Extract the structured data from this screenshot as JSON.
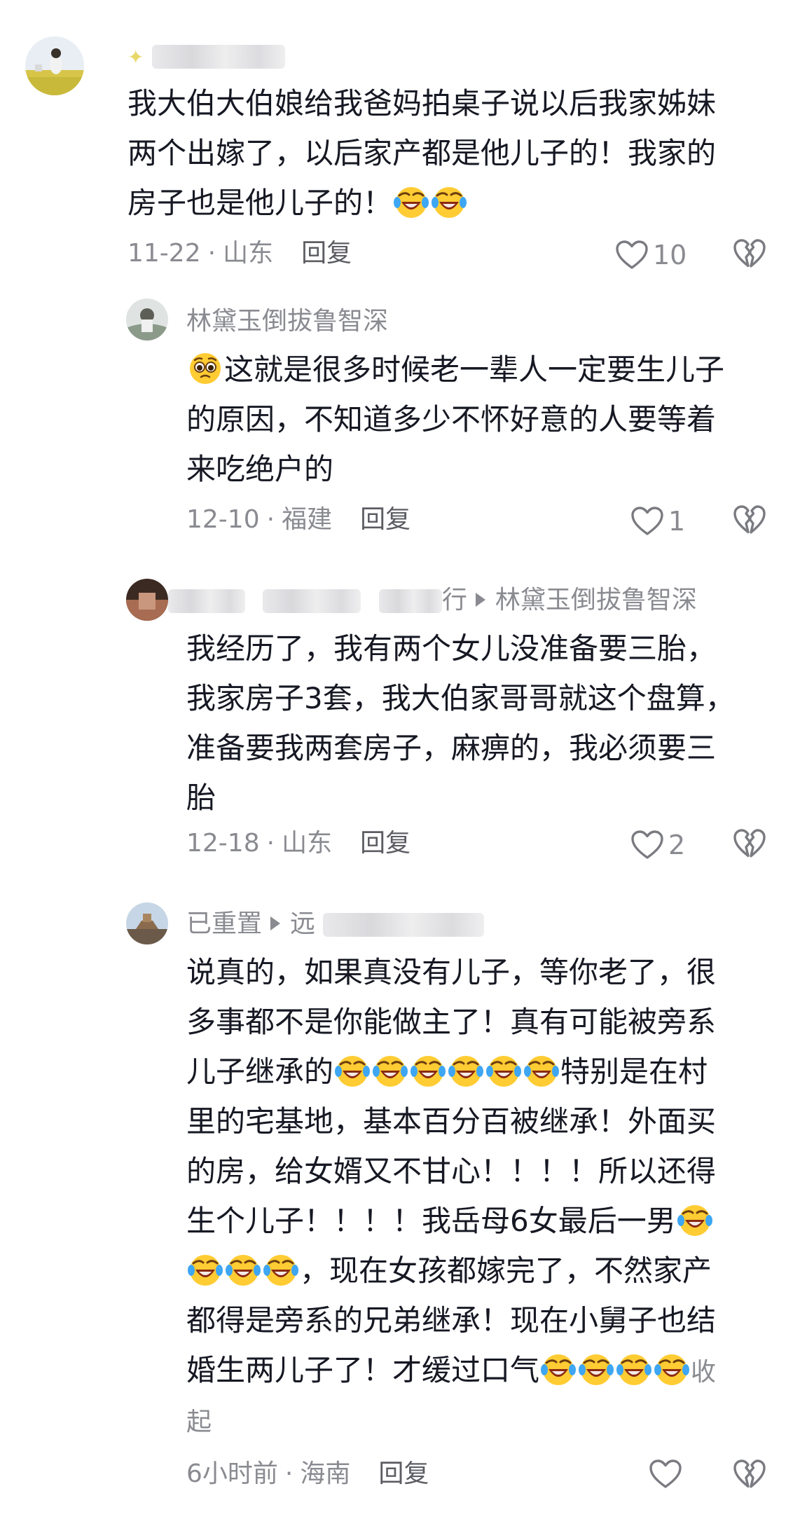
{
  "comments": [
    {
      "author": "",
      "text_lines": [
        "我大伯大伯娘给我爸妈拍桌子说以后我家姊妹",
        "两个出嫁了，以后家产都是他儿子的！我家的",
        "房子也是他儿子的！"
      ],
      "date": "11-22",
      "location": "山东",
      "reply_label": "回复",
      "likes": "10"
    },
    {
      "author": "林黛玉倒拔鲁智深",
      "text_lines": [
        "这就是很多时候老一辈人一定要生儿子",
        "的原因，不知道多少不怀好意的人要等着",
        "来吃绝户的"
      ],
      "date": "12-10",
      "location": "福建",
      "reply_label": "回复",
      "likes": "1"
    },
    {
      "author_partial": "行",
      "reply_to": "林黛玉倒拔鲁智深",
      "text_lines": [
        "我经历了，我有两个女儿没准备要三胎，",
        "我家房子3套，我大伯家哥哥就这个盘算，",
        "准备要我两套房子，麻痹的，我必须要三",
        "胎"
      ],
      "date": "12-18",
      "location": "山东",
      "reply_label": "回复",
      "likes": "2"
    },
    {
      "author": "已重置",
      "reply_to_partial": "远",
      "text_lines": [
        "说真的，如果真没有儿子，等你老了，很",
        "多事都不是你能做主了！真有可能被旁系",
        "儿子继承的",
        "特别是在村",
        "里的宅基地，基本百分百被继承！外面买",
        "的房，给女婿又不甘心！！！！所以还得",
        "生个儿子！！！！我岳母6女最后一男",
        "，现在女孩都嫁完了，不然家产",
        "都得是旁系的兄弟继承！现在小舅子也结",
        "婚生两儿子了！才缓过口气",
        "收",
        "起"
      ],
      "date": "6小时前",
      "location": "海南",
      "reply_label": "回复",
      "likes": ""
    }
  ],
  "icons": {
    "like": "heart-outline-icon",
    "dislike": "broken-heart-outline-icon",
    "emoji_laugh": "laughing-crying-emoji-icon",
    "emoji_pleading": "pleading-face-emoji-icon"
  },
  "colors": {
    "text": "#161823",
    "meta": "#8a8b91",
    "reply": "#5c5d63"
  }
}
